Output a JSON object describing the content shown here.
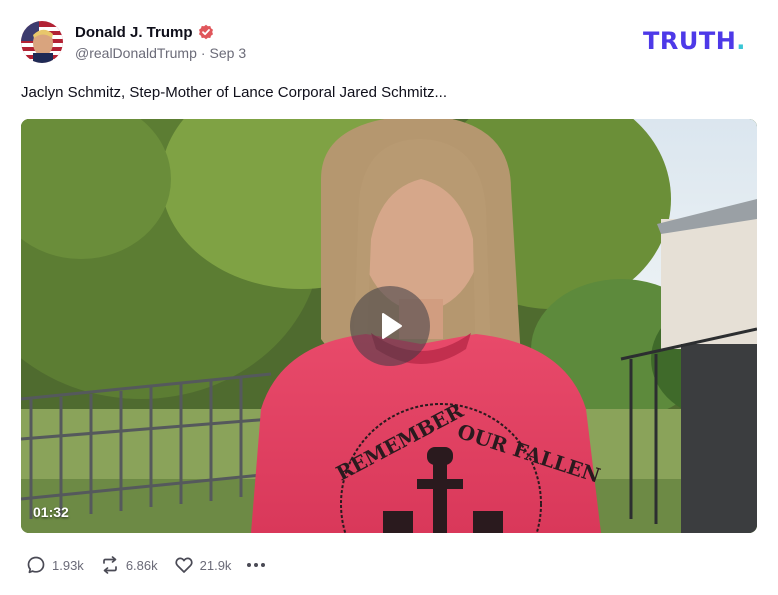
{
  "post": {
    "author": {
      "display_name": "Donald J. Trump",
      "handle": "@realDonaldTrump",
      "separator": "·",
      "date": "Sep 3",
      "verified": true,
      "verified_color": "#e0565b"
    },
    "brand": {
      "logo_text": "TRUTH",
      "logo_dot": ".",
      "logo_color": "#4d39e8",
      "dot_color": "#39c6d6"
    },
    "text": "Jaclyn Schmitz, Step-Mother of Lance Corporal Jared Schmitz...",
    "media": {
      "type": "video",
      "duration": "01:32",
      "shirt_text": "REMEMBER OUR FALLEN",
      "play_icon": "play-icon"
    },
    "actions": {
      "replies": "1.93k",
      "retruths": "6.86k",
      "likes": "21.9k"
    }
  }
}
